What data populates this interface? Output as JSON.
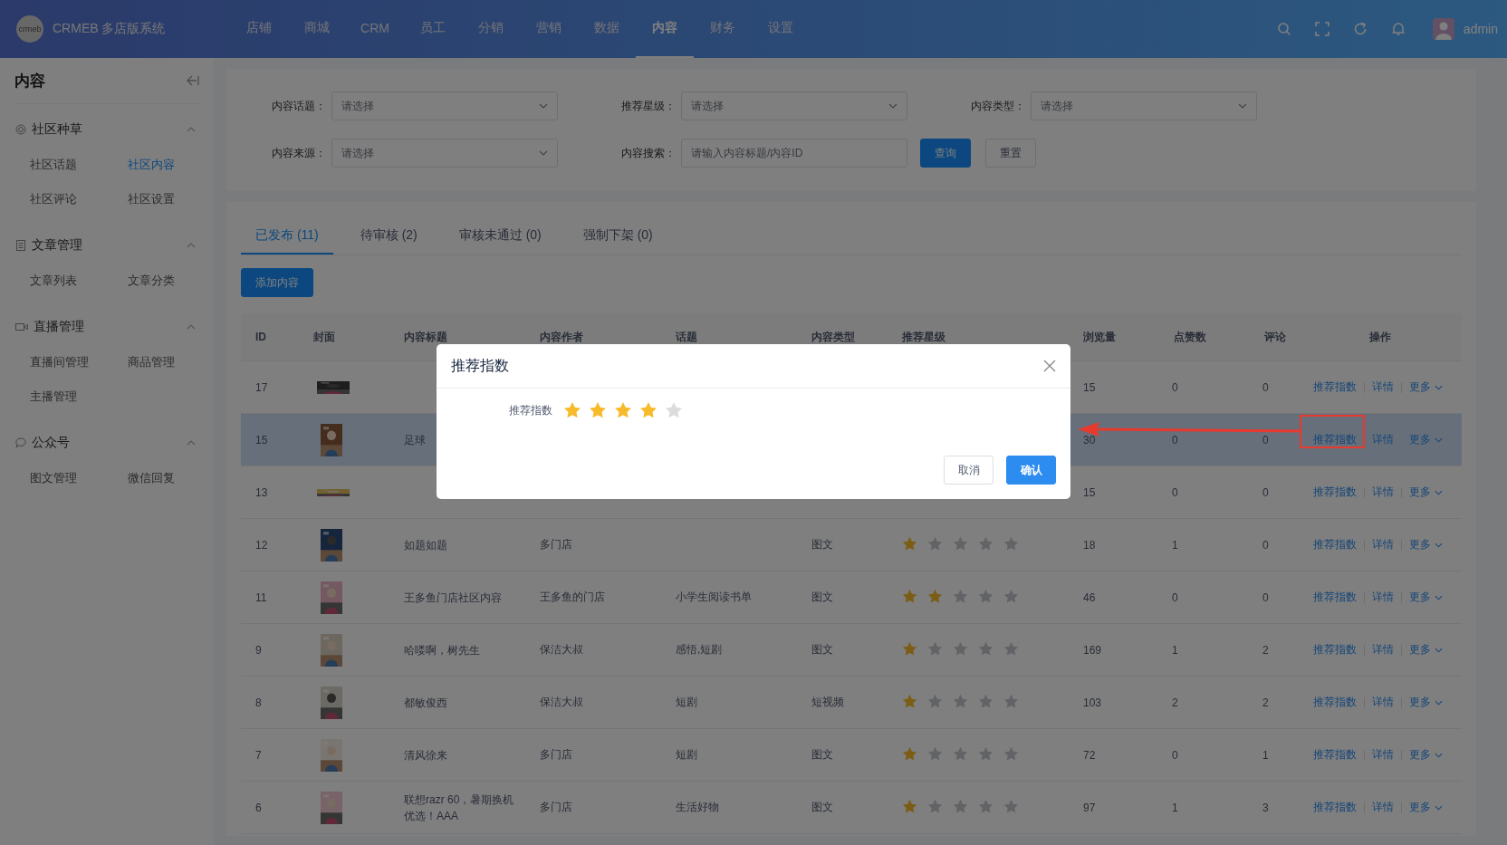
{
  "topbar": {
    "logo": "crmeb",
    "title": "CRMEB 多店版系统",
    "user": "admin",
    "nav": [
      {
        "label": "店铺",
        "selected": false
      },
      {
        "label": "商城",
        "selected": false
      },
      {
        "label": "CRM",
        "selected": false
      },
      {
        "label": "员工",
        "selected": false
      },
      {
        "label": "分销",
        "selected": false
      },
      {
        "label": "营销",
        "selected": false
      },
      {
        "label": "数据",
        "selected": false
      },
      {
        "label": "内容",
        "selected": true
      },
      {
        "label": "财务",
        "selected": false
      },
      {
        "label": "设置",
        "selected": false
      }
    ]
  },
  "sidebar": {
    "title": "内容",
    "groups": [
      {
        "title": "社区种草",
        "expanded": true,
        "items": [
          {
            "label": "社区话题",
            "selected": false
          },
          {
            "label": "社区内容",
            "selected": true
          },
          {
            "label": "社区评论",
            "selected": false
          },
          {
            "label": "社区设置",
            "selected": false
          }
        ]
      },
      {
        "title": "文章管理",
        "expanded": true,
        "items": [
          {
            "label": "文章列表",
            "selected": false
          },
          {
            "label": "文章分类",
            "selected": false
          }
        ]
      },
      {
        "title": "直播管理",
        "expanded": true,
        "items": [
          {
            "label": "直播间管理",
            "selected": false
          },
          {
            "label": "商品管理",
            "selected": false
          },
          {
            "label": "主播管理",
            "selected": false
          }
        ]
      },
      {
        "title": "公众号",
        "expanded": true,
        "items": [
          {
            "label": "图文管理",
            "selected": false
          },
          {
            "label": "微信回复",
            "selected": false
          }
        ]
      }
    ]
  },
  "filters": [
    {
      "label": "内容话题：",
      "kind": "select",
      "placeholder": "请选择"
    },
    {
      "label": "推荐星级：",
      "kind": "select",
      "placeholder": "请选择"
    },
    {
      "label": "内容类型：",
      "kind": "select",
      "placeholder": "请选择"
    },
    {
      "label": "内容来源：",
      "kind": "select",
      "placeholder": "请选择"
    },
    {
      "label": "内容搜索：",
      "kind": "input",
      "placeholder": "请输入内容标题/内容ID"
    }
  ],
  "filter_buttons": [
    {
      "label": "查询",
      "kind": "primary"
    },
    {
      "label": "重置",
      "kind": "plain"
    }
  ],
  "tabs": [
    {
      "label": "已发布 (11)",
      "selected": true
    },
    {
      "label": "待审核 (2)",
      "selected": false
    },
    {
      "label": "审核未通过 (0)",
      "selected": false
    },
    {
      "label": "强制下架 (0)",
      "selected": false
    }
  ],
  "add_button": "添加内容",
  "table": {
    "columns": [
      "ID",
      "封面",
      "内容标题",
      "内容作者",
      "话题",
      "内容类型",
      "推荐星级",
      "浏览量",
      "点赞数",
      "评论",
      "操作"
    ],
    "rows": [
      {
        "id": "17",
        "cover": {
          "kind": "picture"
        },
        "highlighted": false,
        "views": "15",
        "likes": "0",
        "comments": "0",
        "actions": [
          "推荐指数",
          "详情",
          "更多"
        ]
      },
      {
        "id": "15",
        "cover": {
          "kind": "picture"
        },
        "highlighted": true,
        "title": "足球",
        "views": "30",
        "likes": "0",
        "comments": "0",
        "actions": [
          "推荐指数",
          "详情",
          "更多"
        ]
      },
      {
        "id": "13",
        "cover": {
          "kind": "picture"
        },
        "highlighted": false,
        "views": "15",
        "likes": "0",
        "comments": "0",
        "actions": [
          "推荐指数",
          "详情",
          "更多"
        ]
      },
      {
        "id": "12",
        "cover": {
          "kind": "picture"
        },
        "highlighted": false,
        "title": "如题如题",
        "author": "多门店",
        "type": "图文",
        "stars": 1,
        "views": "18",
        "likes": "1",
        "comments": "0",
        "actions": [
          "推荐指数",
          "详情",
          "更多"
        ]
      },
      {
        "id": "11",
        "cover": {
          "kind": "picture"
        },
        "highlighted": false,
        "title": "王多鱼门店社区内容",
        "author": "王多鱼的门店",
        "topic": "小学生阅读书单",
        "type": "图文",
        "stars": 2,
        "views": "46",
        "likes": "0",
        "comments": "0",
        "actions": [
          "推荐指数",
          "详情",
          "更多"
        ]
      },
      {
        "id": "9",
        "cover": {
          "kind": "picture"
        },
        "highlighted": false,
        "title": "哈喽啊，树先生",
        "author": "保洁大叔",
        "topic": "感悟,短剧",
        "type": "图文",
        "stars": 1,
        "views": "169",
        "likes": "1",
        "comments": "2",
        "actions": [
          "推荐指数",
          "详情",
          "更多"
        ]
      },
      {
        "id": "8",
        "cover": {
          "kind": "picture"
        },
        "highlighted": false,
        "title": "都敏俊西",
        "author": "保洁大叔",
        "topic": "短剧",
        "type": "短视频",
        "stars": 1,
        "views": "103",
        "likes": "2",
        "comments": "2",
        "actions": [
          "推荐指数",
          "详情",
          "更多"
        ]
      },
      {
        "id": "7",
        "cover": {
          "kind": "picture"
        },
        "highlighted": false,
        "title": "清风徐来",
        "author": "多门店",
        "topic": "短剧",
        "type": "图文",
        "stars": 1,
        "views": "72",
        "likes": "0",
        "comments": "1",
        "actions": [
          "推荐指数",
          "详情",
          "更多"
        ]
      },
      {
        "id": "6",
        "cover": {
          "kind": "picture"
        },
        "highlighted": false,
        "title": "联想razr 60，暑期换机优选！AAA",
        "author": "多门店",
        "topic": "生活好物",
        "type": "图文",
        "stars": 1,
        "views": "97",
        "likes": "1",
        "comments": "3",
        "actions": [
          "推荐指数",
          "详情",
          "更多"
        ]
      }
    ]
  },
  "modal": {
    "title": "推荐指数",
    "field_label": "推荐指数",
    "stars": 4,
    "buttons": [
      {
        "label": "取消",
        "kind": "plain"
      },
      {
        "label": "确认",
        "kind": "primary"
      }
    ]
  }
}
